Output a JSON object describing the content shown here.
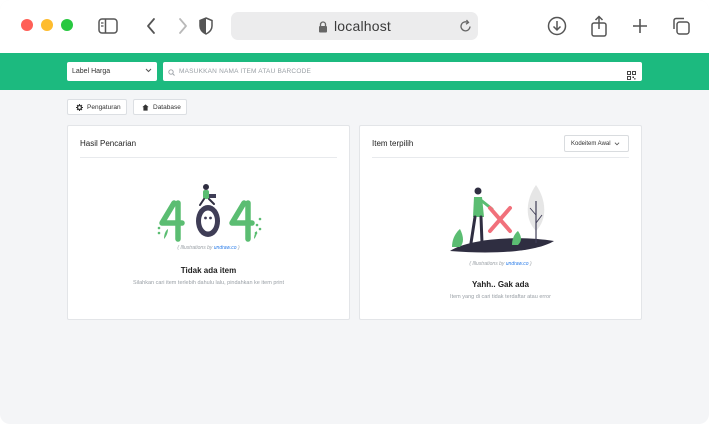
{
  "browser": {
    "url": "localhost"
  },
  "toolbar": {
    "select_value": "Label Harga",
    "search_placeholder": "MASUKKAN NAMA ITEM ATAU BARCODE"
  },
  "actions": {
    "settings_label": "Pengaturan",
    "database_label": "Database"
  },
  "results_panel": {
    "title": "Hasil Pencarian",
    "credit_prefix": "( Illustrations by ",
    "credit_link": "undraw.co",
    "credit_suffix": " )",
    "empty_heading": "Tidak ada item",
    "empty_text": "Silahkan cari item terlebih dahulu lalu, pindahkan ke item print"
  },
  "selected_panel": {
    "title": "Item terpilih",
    "sort_value": "Kodeitem Awal",
    "credit_prefix": "( Illustrations by ",
    "credit_link": "undraw.co",
    "credit_suffix": " )",
    "empty_heading": "Yahh.. Gak ada",
    "empty_text": "Item yang di cari tidak terdaftar atau error"
  },
  "colors": {
    "accent": "#1cba7f",
    "illustration_green": "#5bbd72",
    "error_pink": "#f1707b"
  }
}
